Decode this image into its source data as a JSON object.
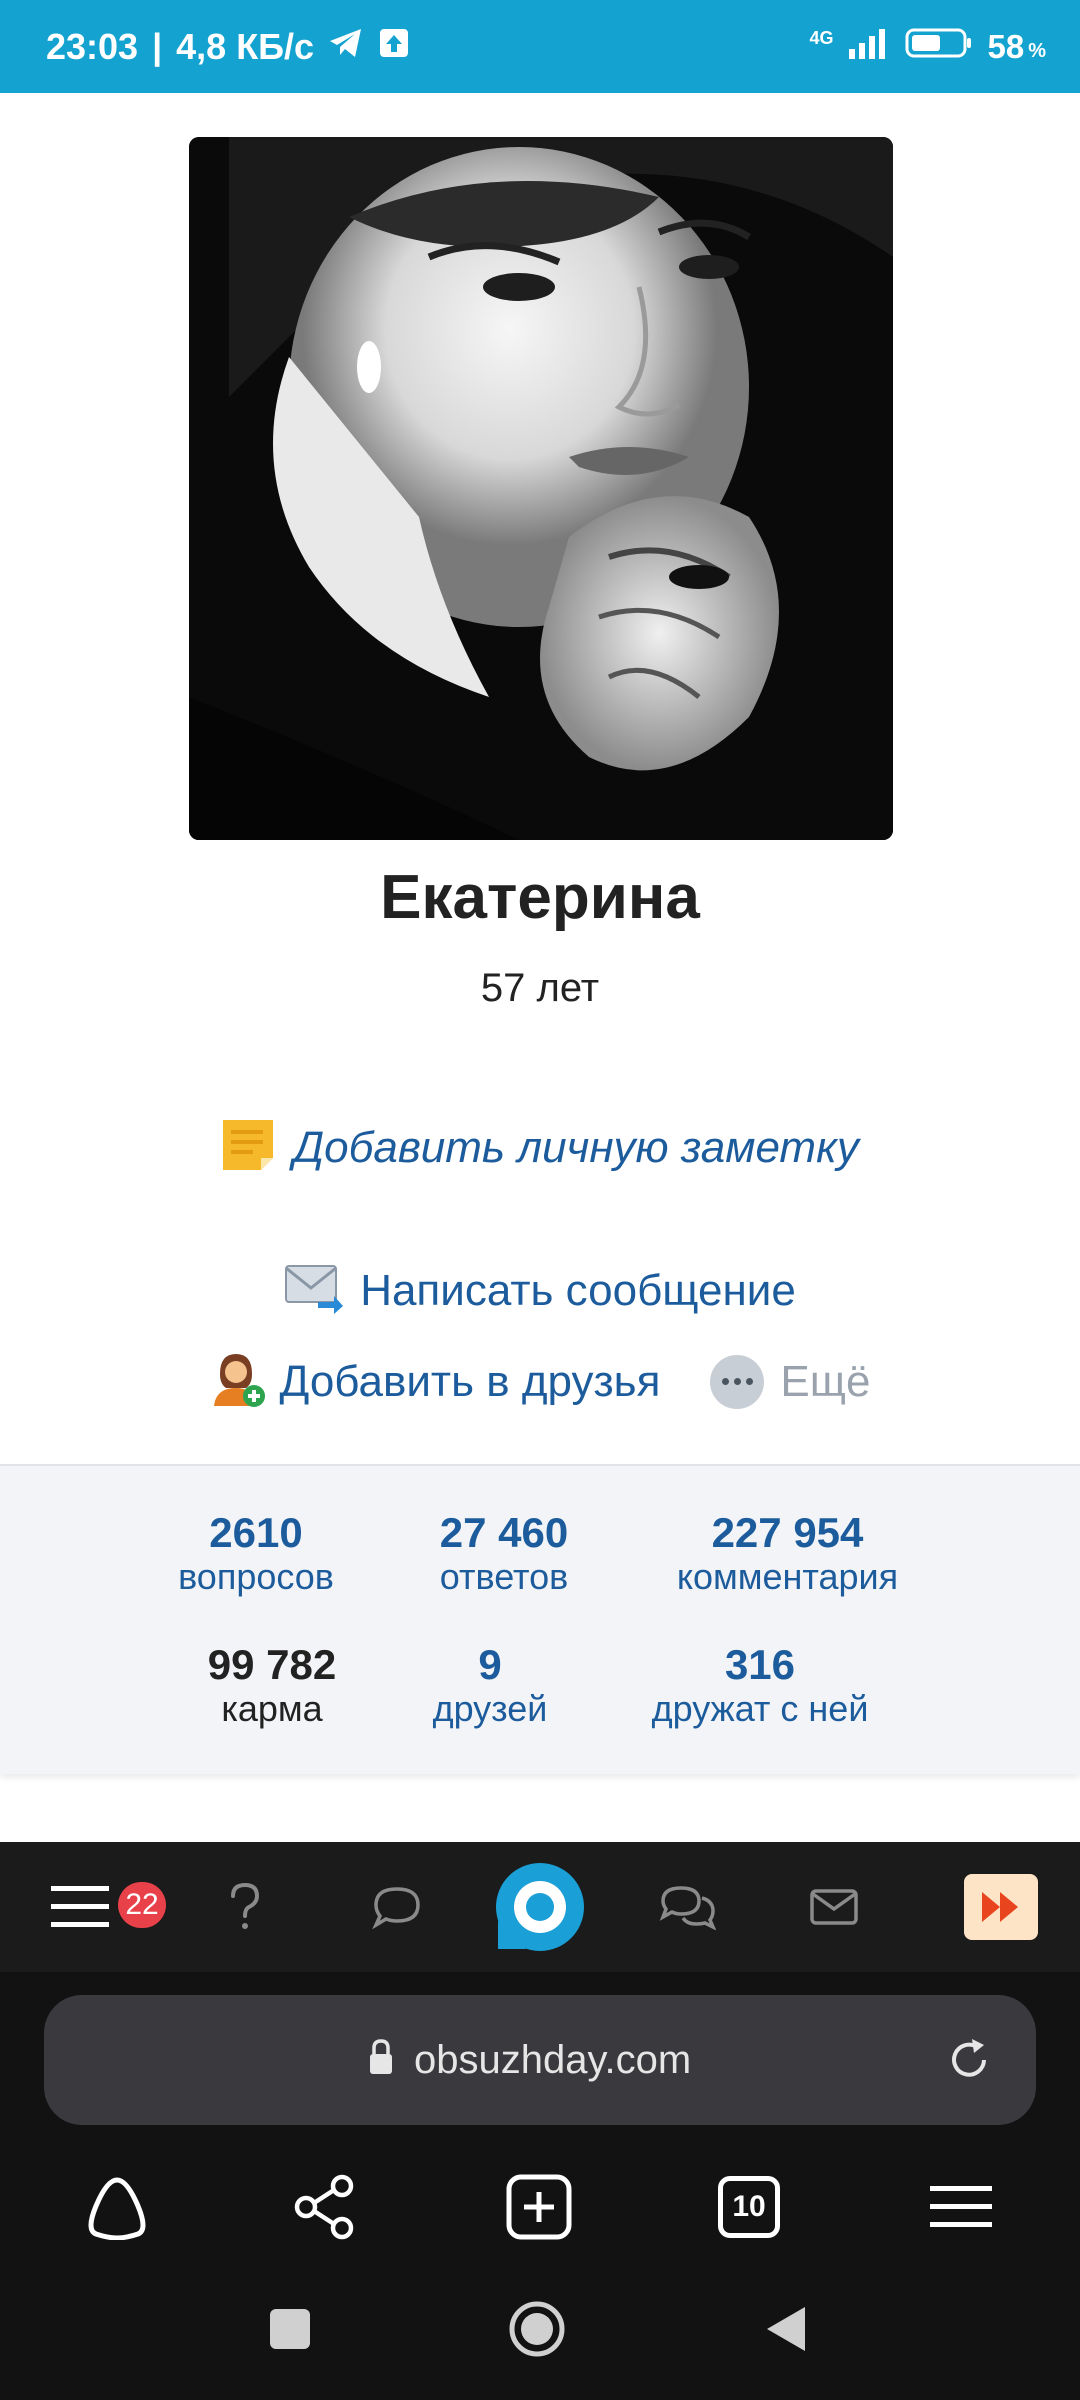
{
  "status_bar": {
    "time": "23:03",
    "separator": "|",
    "speed": "4,8 КБ/с",
    "network": "4G",
    "battery": "58",
    "battery_unit": "%"
  },
  "profile": {
    "name": "Екатерина",
    "age": "57 лет",
    "add_note": "Добавить личную заметку",
    "send_message": "Написать сообщение",
    "add_friend": "Добавить в друзья",
    "more": "Ещё"
  },
  "stats": [
    {
      "value": "2610",
      "label": "вопросов"
    },
    {
      "value": "27 460",
      "label": "ответов"
    },
    {
      "value": "227 954",
      "label": "комментария"
    },
    {
      "value": "99 782",
      "label": "карма"
    },
    {
      "value": "9",
      "label": "друзей"
    },
    {
      "value": "316",
      "label": "дружат с ней"
    }
  ],
  "site_nav": {
    "menu_badge": "22"
  },
  "browser": {
    "url": "obsuzhday.com",
    "tabs_count": "10"
  },
  "colors": {
    "status_bar": "#14a3d0",
    "link": "#1d5c9c",
    "badge": "#e8414a",
    "brand": "#1a9fd6"
  }
}
